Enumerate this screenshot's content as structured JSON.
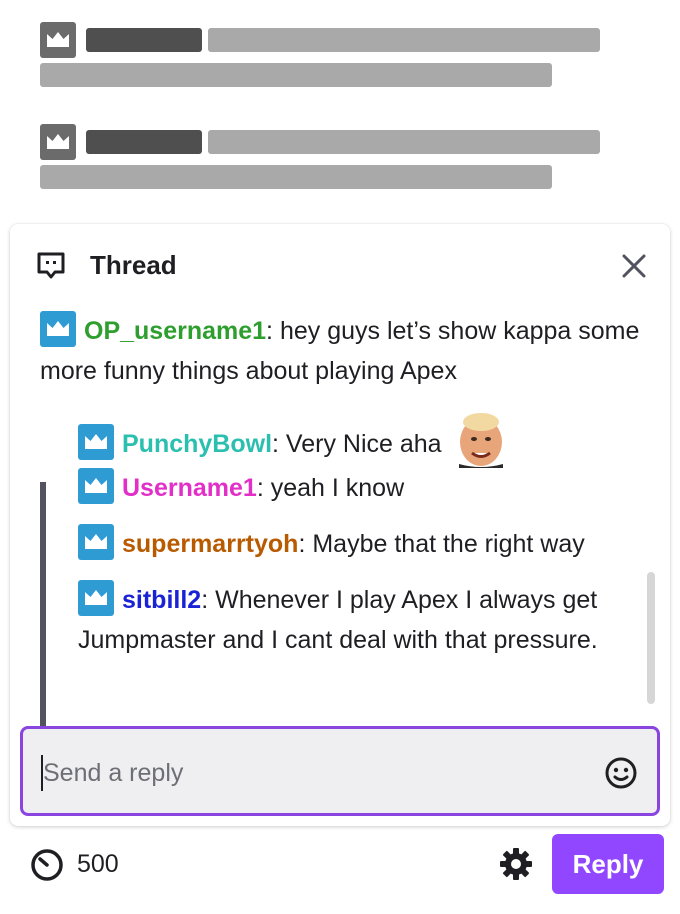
{
  "thread": {
    "title": "Thread",
    "parent": {
      "username": "OP_username1",
      "username_color": "#2e9e2e",
      "separator": ":",
      "text": "hey guys let’s show kappa some more funny things about playing Apex"
    },
    "replies": [
      {
        "username": "PunchyBowl",
        "username_color": "#2bbfaf",
        "separator": ":",
        "text": "Very Nice aha",
        "emote": "kappa-face-emote"
      },
      {
        "username": "Username1",
        "username_color": "#e22fc7",
        "separator": ":",
        "text": "yeah I know"
      },
      {
        "username": "supermarrtyoh",
        "username_color": "#b85a00",
        "separator": ":",
        "text": "Maybe that the right way"
      },
      {
        "username": "sitbill2",
        "username_color": "#1a22d6",
        "separator": ":",
        "text": "Whenever I play Apex I always get Jumpmaster and I cant deal with that pressure."
      }
    ]
  },
  "reply_input": {
    "placeholder": "Send a reply"
  },
  "footer": {
    "points": "500",
    "reply_button": "Reply"
  },
  "colors": {
    "accent": "#9147ff",
    "input_border": "#8a45e0",
    "badge": "#2f9bd3"
  }
}
